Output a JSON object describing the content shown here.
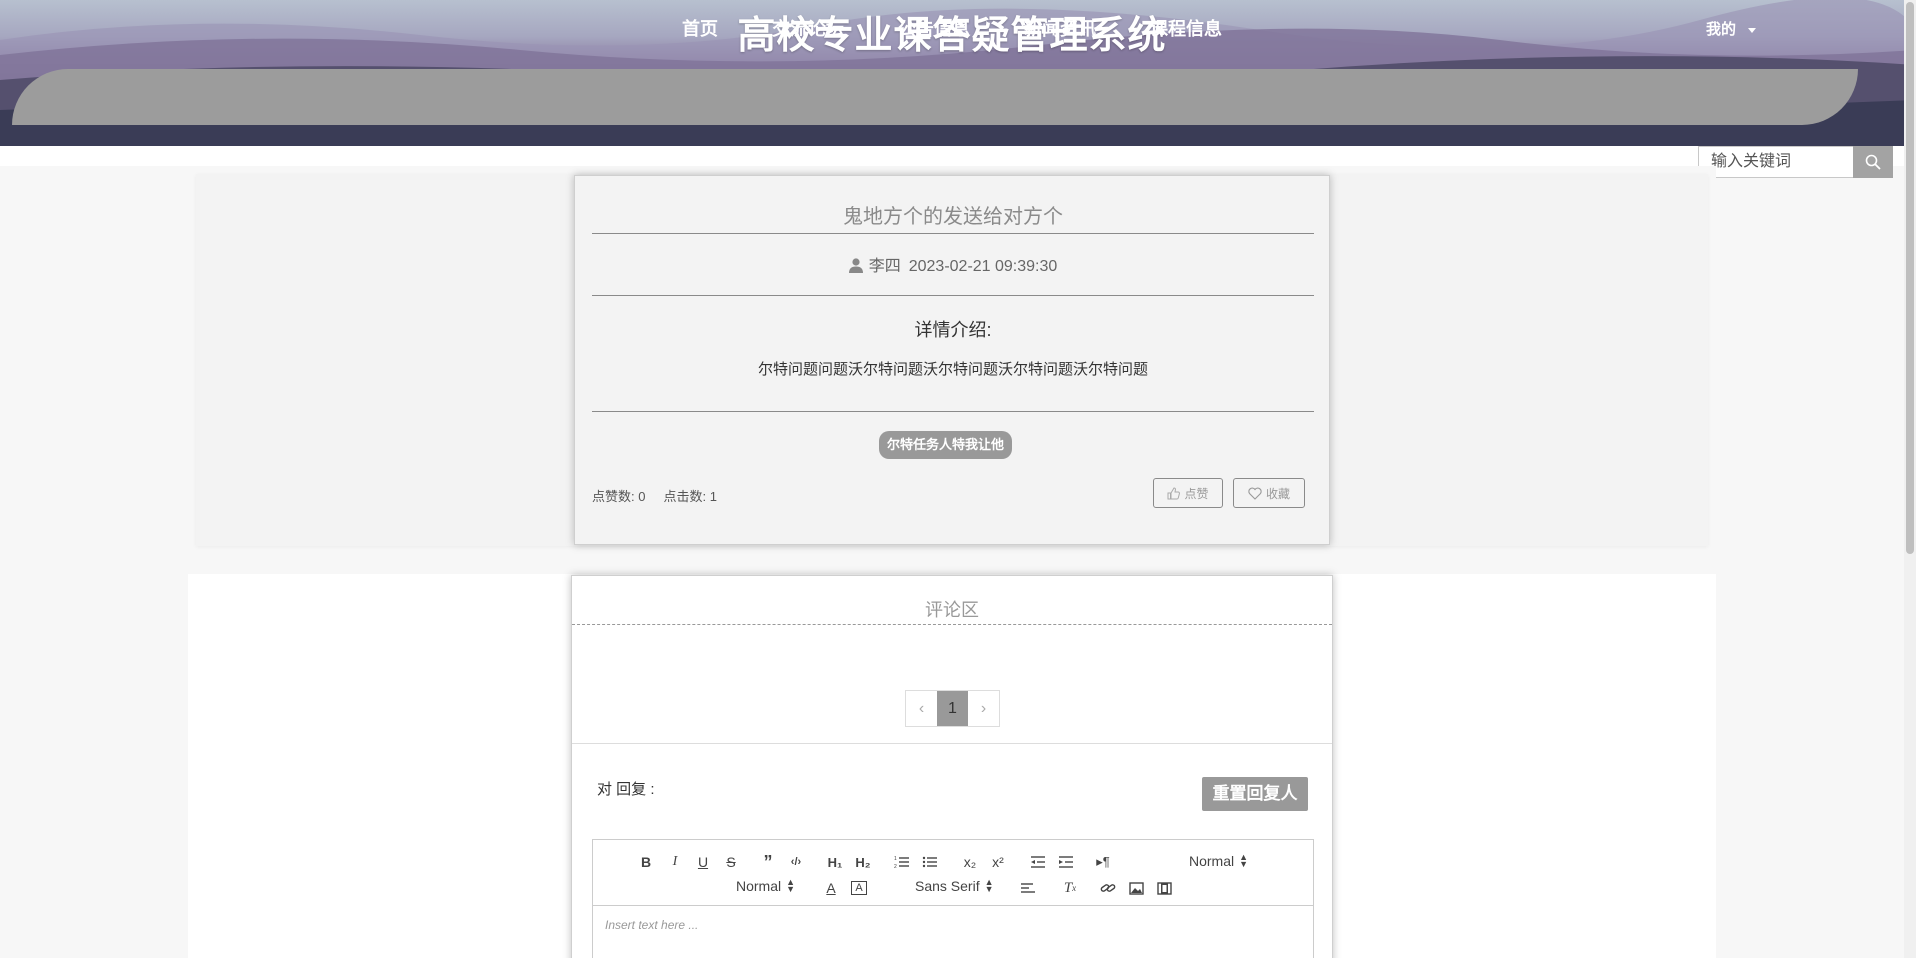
{
  "header": {
    "site_title": "高校专业课答疑管理系统",
    "nav": [
      "首页",
      "交流论坛",
      "公告信息",
      "新闻资讯",
      "课程信息"
    ],
    "mine_label": "我的"
  },
  "search": {
    "placeholder": "输入关键词"
  },
  "post": {
    "title": "鬼地方个的发送给对方个",
    "author": "李四",
    "datetime": "2023-02-21 09:39:30",
    "intro_heading": "详情介绍:",
    "intro_text": "尔特问题问题沃尔特问题沃尔特问题沃尔特问题沃尔特问题",
    "tag": "尔特任务人特我让他",
    "likes_label": "点赞数: 0",
    "clicks_label": "点击数: 1",
    "like_button": "点赞",
    "favorite_button": "收藏"
  },
  "comments": {
    "title": "评论区",
    "pager": {
      "prev": "‹",
      "current": "1",
      "next": "›"
    },
    "reply_label": "对 回复 :",
    "reset_button": "重置回复人",
    "editor": {
      "header_select": "Normal",
      "size_select": "Normal",
      "font_select": "Sans Serif",
      "placeholder": "Insert text here ..."
    }
  },
  "colors": {
    "accent_gray": "#999999",
    "nav_bg": "#9c9c9c"
  }
}
